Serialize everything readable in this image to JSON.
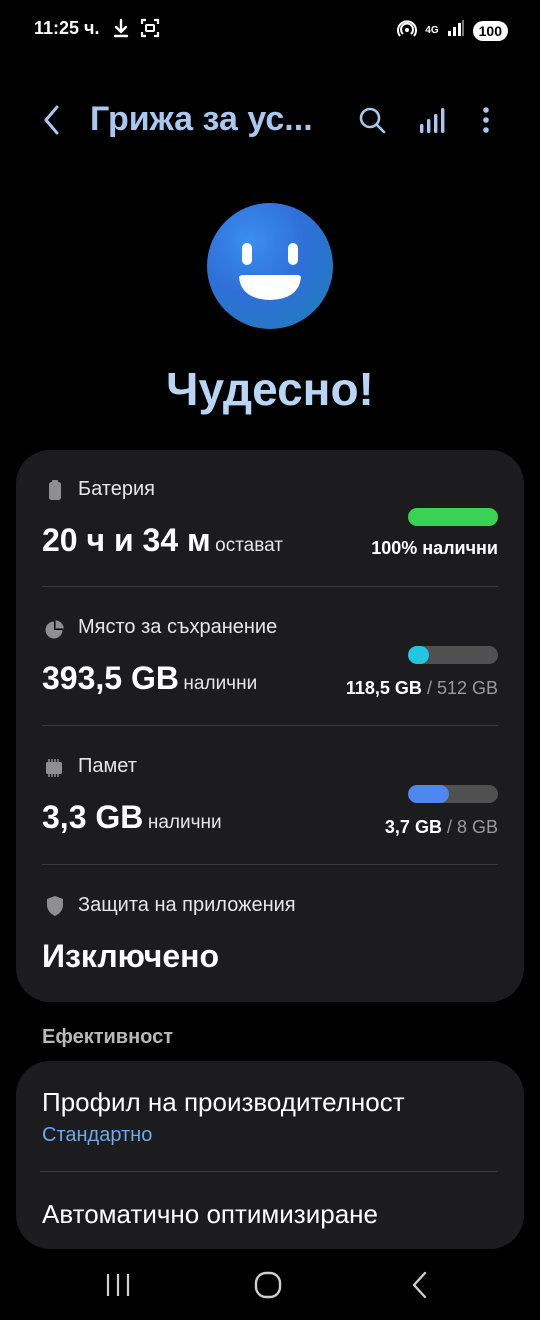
{
  "status_bar": {
    "time": "11:25 ч.",
    "network": "4G",
    "battery": "100"
  },
  "header": {
    "title": "Грижа за ус...",
    "icons": [
      "back-icon",
      "search-icon",
      "stats-icon",
      "more-icon"
    ]
  },
  "device_status": {
    "headline": "Чудесно!"
  },
  "battery": {
    "label": "Батерия",
    "value": "20 ч и 34 м",
    "unit": "остават",
    "detail": "100% налични",
    "level": 1.0,
    "color": "#39d353"
  },
  "storage": {
    "label": "Място за съхранение",
    "value": "393,5 GB",
    "unit": "налични",
    "used": "118,5 GB",
    "total": "/ 512 GB",
    "level": 0.23,
    "color": "#22c6e0"
  },
  "memory": {
    "label": "Памет",
    "value": "3,3 GB",
    "unit": "налични",
    "used": "3,7 GB",
    "total": "/ 8 GB",
    "level": 0.46,
    "color": "#4f86f0"
  },
  "app_protection": {
    "label": "Защита на приложения",
    "value": "Изключено"
  },
  "efficiency": {
    "section_label": "Ефективност",
    "items": [
      {
        "title": "Профил на производителност",
        "subtitle": "Стандартно"
      },
      {
        "title": "Автоматично оптимизиране"
      }
    ]
  },
  "nav_bar": {
    "icons": [
      "recents-icon",
      "home-icon",
      "back-nav-icon"
    ]
  }
}
